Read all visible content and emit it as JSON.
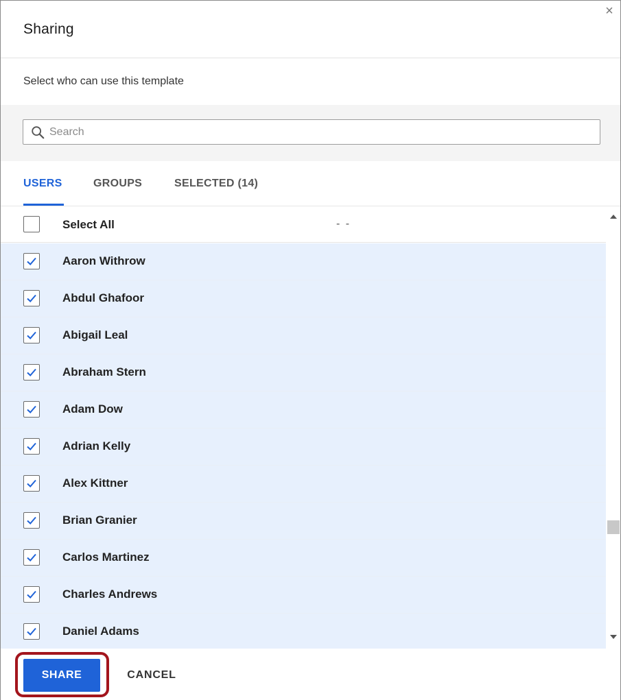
{
  "dialog": {
    "title": "Sharing",
    "close_glyph": "×",
    "subtitle": "Select who can use this template"
  },
  "search": {
    "placeholder": "Search",
    "value": ""
  },
  "tabs": [
    {
      "label": "USERS",
      "active": true
    },
    {
      "label": "GROUPS",
      "active": false
    },
    {
      "label": "SELECTED (14)",
      "active": false
    }
  ],
  "list": {
    "select_all_label": "Select All",
    "select_all_checked": false,
    "select_all_extra": "- -",
    "users": [
      {
        "name": "Aaron Withrow",
        "checked": true
      },
      {
        "name": "Abdul Ghafoor",
        "checked": true
      },
      {
        "name": "Abigail Leal",
        "checked": true
      },
      {
        "name": "Abraham Stern",
        "checked": true
      },
      {
        "name": "Adam Dow",
        "checked": true
      },
      {
        "name": "Adrian Kelly",
        "checked": true
      },
      {
        "name": "Alex Kittner",
        "checked": true
      },
      {
        "name": "Brian Granier",
        "checked": true
      },
      {
        "name": "Carlos Martinez",
        "checked": true
      },
      {
        "name": "Charles Andrews",
        "checked": true
      },
      {
        "name": "Daniel Adams",
        "checked": true
      }
    ]
  },
  "footer": {
    "share_label": "SHARE",
    "cancel_label": "CANCEL"
  },
  "colors": {
    "accent": "#1f63d8",
    "selected_row": "#e7f0fd",
    "highlight_ring": "#a3151d"
  }
}
